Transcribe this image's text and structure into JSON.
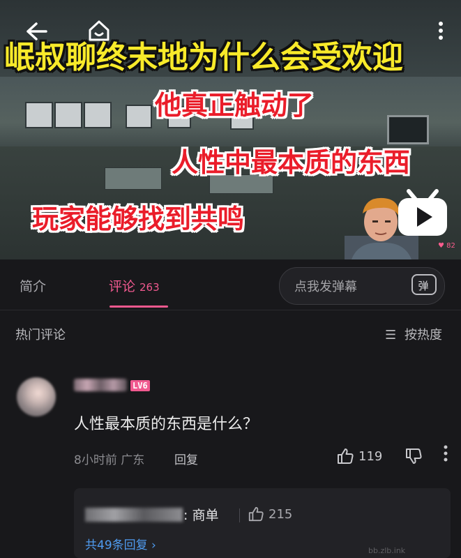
{
  "video": {
    "overlay": {
      "line1": "岷叔聊终末地为什么会受欢迎",
      "line2": "他真正触动了",
      "line3": "人性中最本质的东西",
      "line4": "玩家能够找到共鸣"
    },
    "like_count": "82",
    "back_icon": "back-arrow-icon",
    "home_icon": "home-icon",
    "more_icon": "more-vertical-icon"
  },
  "tabs": {
    "intro": "简介",
    "comments": "评论",
    "comments_count": "263",
    "danmaku_placeholder": "点我发弹幕",
    "danmaku_icon_label": "弹"
  },
  "section": {
    "title": "热门评论",
    "sort_label": "按热度"
  },
  "comment": {
    "level": "LV6",
    "text": "人性最本质的东西是什么？",
    "time_location": "8小时前 广东",
    "reply_label": "回复",
    "like_count": "119"
  },
  "reply": {
    "text": ": 商单",
    "like_count": "215",
    "view_all": "共49条回复 ›"
  },
  "watermark": "bb.zlb.ink",
  "colors": {
    "accent": "#f0598f",
    "link": "#4f9bef",
    "background": "#18181b"
  }
}
